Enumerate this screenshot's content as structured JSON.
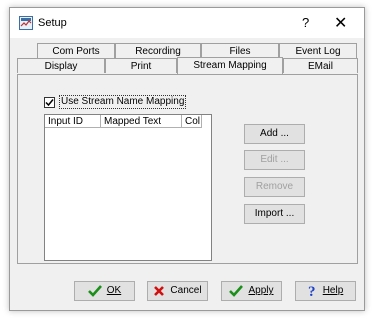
{
  "window": {
    "title": "Setup",
    "help_glyph": "?",
    "close_glyph": "✕"
  },
  "tabs_back": [
    "Com Ports",
    "Recording",
    "Files",
    "Event Log"
  ],
  "tabs_front": [
    "Display",
    "Print",
    "Stream Mapping",
    "EMail"
  ],
  "selected_tab": "Stream Mapping",
  "mapping": {
    "checkbox_label": "Use Stream Name Mapping",
    "checked": true,
    "columns": [
      "Input ID",
      "Mapped Text",
      "Col"
    ],
    "rows": []
  },
  "side_buttons": {
    "add": "Add ...",
    "edit": "Edit ...",
    "remove": "Remove",
    "import": "Import ..."
  },
  "bottom_buttons": {
    "ok": "OK",
    "cancel": "Cancel",
    "apply": "Apply",
    "help": "Help"
  },
  "colors": {
    "ok_check": "#1a8f1a",
    "cancel_x": "#d01010",
    "help_q": "#1a3fc8"
  }
}
